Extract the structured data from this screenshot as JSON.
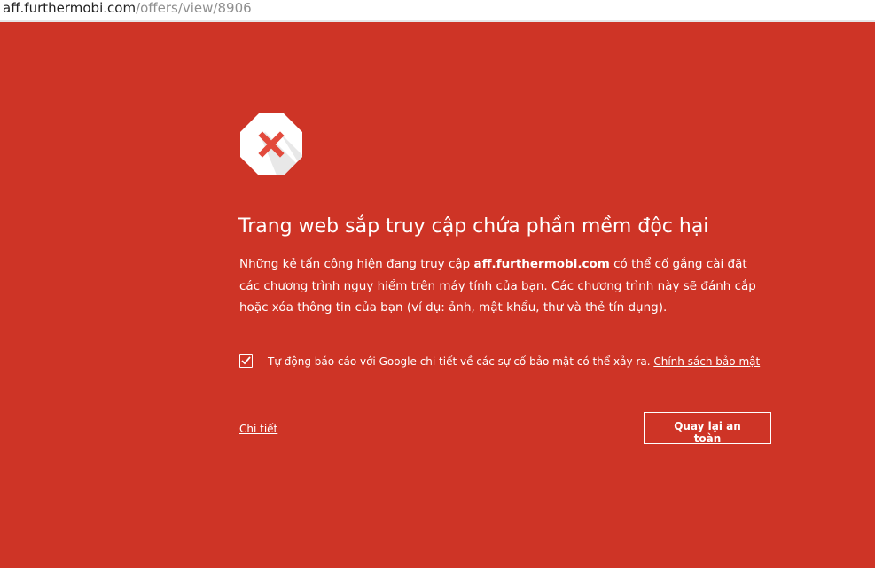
{
  "address_bar": {
    "domain": "aff.furthermobi.com",
    "path": "/offers/view/8906"
  },
  "interstitial": {
    "icon": "stop-sign-icon",
    "heading": "Trang web sắp truy cập chứa phần mềm độc hại",
    "body_prefix": "Những kẻ tấn công hiện đang truy cập ",
    "body_site": "aff.furthermobi.com",
    "body_suffix": " có thể cố gắng cài đặt các chương trình nguy hiểm trên máy tính của bạn. Các chương trình này sẽ đánh cắp hoặc xóa thông tin của bạn (ví dụ: ảnh, mật khẩu, thư và thẻ tín dụng).",
    "report_checked": true,
    "report_text": "Tự động báo cáo với Google chi tiết về các sự cố bảo mật có thể xảy ra.",
    "privacy_link": "Chính sách bảo mật",
    "details_link": "Chi tiết",
    "back_button": "Quay lại an toàn"
  },
  "colors": {
    "background": "#ce3426",
    "foreground": "#ffffff",
    "icon_x": "#e24a3c"
  }
}
